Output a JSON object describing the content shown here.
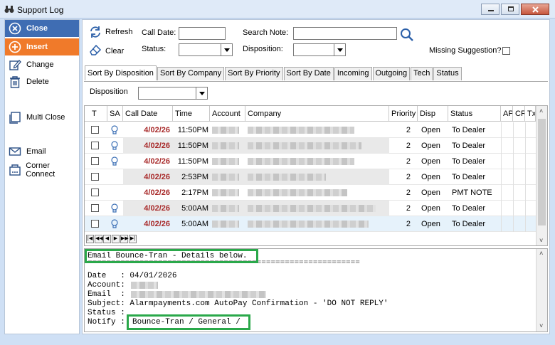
{
  "window": {
    "title": "Support Log"
  },
  "sidebar": {
    "items": [
      {
        "label": "Close",
        "icon": "close-circle-icon"
      },
      {
        "label": "Insert",
        "icon": "plus-circle-icon"
      },
      {
        "label": "Change",
        "icon": "edit-icon"
      },
      {
        "label": "Delete",
        "icon": "trash-icon"
      },
      {
        "label": "Multi Close",
        "icon": "multi-window-icon"
      },
      {
        "label": "Email",
        "icon": "envelope-icon"
      },
      {
        "label": "Corner Connect",
        "icon": "corner-connect-icon"
      }
    ]
  },
  "toolbar": {
    "refresh_label": "Refresh",
    "clear_label": "Clear",
    "call_date_label": "Call Date:",
    "call_date_value": "",
    "status_label": "Status:",
    "status_value": "",
    "search_note_label": "Search Note:",
    "search_note_value": "",
    "disposition_label": "Disposition:",
    "disposition_value": "",
    "missing_suggestion_label": "Missing Suggestion?"
  },
  "tabs": [
    "Sort By Disposition",
    "Sort By Company",
    "Sort By Priority",
    "Sort By Date",
    "Incoming",
    "Outgoing",
    "Tech",
    "Status"
  ],
  "tab_panel": {
    "disposition_label": "Disposition",
    "disposition_value": ""
  },
  "grid": {
    "columns": [
      "T",
      "SA",
      "Call Date",
      "Time",
      "Account",
      "Company",
      "Priority",
      "Disp",
      "Status",
      "AP",
      "CR",
      "Tx"
    ],
    "rows": [
      {
        "call_date": "4/02/26",
        "time": "11:50PM",
        "priority": "2",
        "disp": "Open",
        "status": "To Dealer",
        "sa": true
      },
      {
        "call_date": "4/02/26",
        "time": "11:50PM",
        "priority": "2",
        "disp": "Open",
        "status": "To Dealer",
        "sa": true
      },
      {
        "call_date": "4/02/26",
        "time": "11:50PM",
        "priority": "2",
        "disp": "Open",
        "status": "To Dealer",
        "sa": true
      },
      {
        "call_date": "4/02/26",
        "time": "2:53PM",
        "priority": "2",
        "disp": "Open",
        "status": "To Dealer",
        "sa": false
      },
      {
        "call_date": "4/02/26",
        "time": "2:17PM",
        "priority": "2",
        "disp": "Open",
        "status": "PMT NOTE",
        "sa": false
      },
      {
        "call_date": "4/02/26",
        "time": "5:00AM",
        "priority": "2",
        "disp": "Open",
        "status": "To Dealer",
        "sa": true
      },
      {
        "call_date": "4/02/26",
        "time": "5:00AM",
        "priority": "2",
        "disp": "Open",
        "status": "To Dealer",
        "sa": true
      }
    ],
    "nav": [
      "|◀",
      "◀◀",
      "◀",
      "▶",
      "▶▶",
      "▶|"
    ]
  },
  "memo": {
    "header": "Email Bounce-Tran - Details below.",
    "separator": "==========================================================",
    "date_line": "Date   : 04/01/2026",
    "account_line": "Account:",
    "email_line": "Email  :",
    "subject_line": "Subject: Alarmpayments.com AutoPay Confirmation - 'DO NOT REPLY'",
    "status_line": "Status :",
    "notify_label": "Notify : ",
    "notify_value": "Bounce-Tran / General /"
  },
  "colors": {
    "close_btn": "#3f6db3",
    "insert_btn": "#f07a2a",
    "date_red": "#a82a2a",
    "highlight_green": "#2aa84a"
  }
}
